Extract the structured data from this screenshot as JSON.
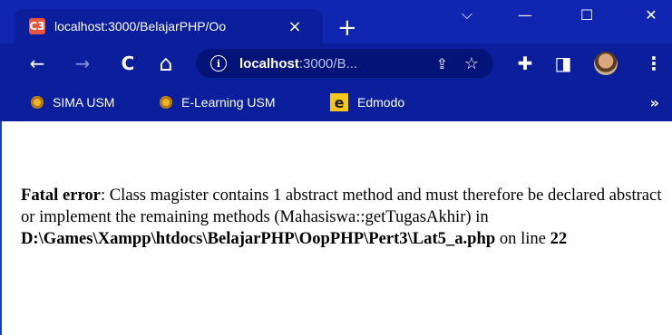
{
  "tab": {
    "favicon": "C3",
    "title": "localhost:3000/BelajarPHP/Oo",
    "close": "×",
    "new_tab": "+"
  },
  "window_controls": {
    "tab_search": "⌵",
    "minimize": "—",
    "maximize": "☐",
    "close": "✕"
  },
  "toolbar": {
    "back": "←",
    "forward": "→",
    "reload": "C",
    "home": "⌂",
    "info": "i",
    "url_host": "localhost",
    "url_rest": ":3000/B...",
    "share": "⇪",
    "star": "☆",
    "extensions": "✚",
    "sidepanel": "◨",
    "menu": "⋮"
  },
  "bookmarks": {
    "items": [
      {
        "label": "SIMA USM",
        "icon": "usm-logo-icon"
      },
      {
        "label": "E-Learning USM",
        "icon": "usm-logo-icon"
      },
      {
        "label": "Edmodo",
        "icon": "edmodo-icon",
        "glyph": "e"
      }
    ],
    "more": "»"
  },
  "error": {
    "label": "Fatal error",
    "message": ": Class magister contains 1 abstract method and must therefore be declared abstract or implement the remaining methods (Mahasiswa::getTugasAkhir) in ",
    "path": "D:\\Games\\Xampp\\htdocs\\BelajarPHP\\OopPHP\\Pert3\\Lat5_a.php",
    "line_prefix": " on line ",
    "line_number": "22"
  },
  "colors": {
    "tab_strip": "#1126b0",
    "toolbar": "#0b1f9c",
    "omnibox": "#041378"
  }
}
